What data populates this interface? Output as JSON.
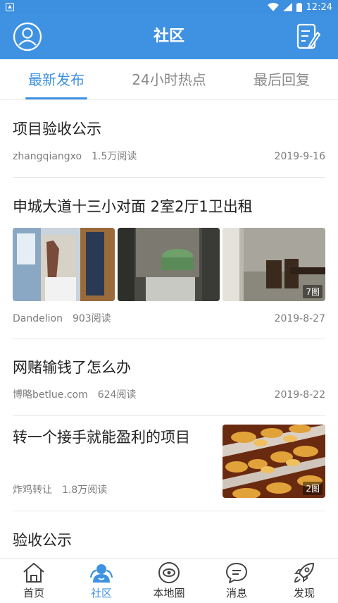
{
  "status_bar": {
    "time": "12:24"
  },
  "app_bar": {
    "title": "社区",
    "left_icon": "avatar-icon",
    "right_icon": "edit-note-icon"
  },
  "tabs": [
    {
      "label": "最新发布",
      "active": true
    },
    {
      "label": "24小时热点",
      "active": false
    },
    {
      "label": "最后回复",
      "active": false
    }
  ],
  "posts": [
    {
      "title": "项目验收公示",
      "author": "zhangqiangxo",
      "reads": "1.5万阅读",
      "date": "2019-9-16"
    },
    {
      "title": "申城大道十三小对面 2室2厅1卫出租",
      "author": "Dandelion",
      "reads": "903阅读",
      "date": "2019-8-27",
      "image_count": "7图"
    },
    {
      "title": "网赌输钱了怎么办",
      "author": "博略betlue.com",
      "reads": "624阅读",
      "date": "2019-8-22"
    },
    {
      "title": "转一个接手就能盈利的项目",
      "author": "炸鸡转让",
      "reads": "1.8万阅读",
      "image_count": "2图"
    },
    {
      "title": "验收公示"
    }
  ],
  "bottom_nav": [
    {
      "label": "首页",
      "icon": "home-icon",
      "active": false
    },
    {
      "label": "社区",
      "icon": "community-icon",
      "active": true
    },
    {
      "label": "本地圈",
      "icon": "local-circle-icon",
      "active": false
    },
    {
      "label": "消息",
      "icon": "message-icon",
      "active": false
    },
    {
      "label": "发现",
      "icon": "rocket-icon",
      "active": false
    }
  ],
  "colors": {
    "primary": "#3f92e2",
    "text": "#222222",
    "meta": "#7d7d7d"
  }
}
